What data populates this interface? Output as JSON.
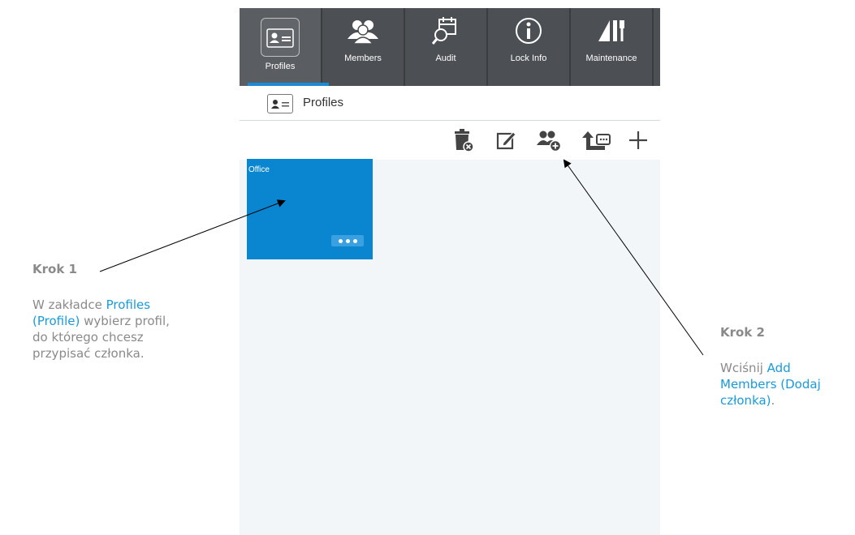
{
  "tabs": [
    {
      "label": "Profiles",
      "icon": "profile-card-icon",
      "active": true
    },
    {
      "label": "Members",
      "icon": "members-icon",
      "active": false
    },
    {
      "label": "Audit",
      "icon": "audit-icon",
      "active": false
    },
    {
      "label": "Lock Info",
      "icon": "info-icon",
      "active": false
    },
    {
      "label": "Maintenance",
      "icon": "maintenance-icon",
      "active": false
    }
  ],
  "breadcrumb": {
    "label": "Profiles",
    "icon": "profile-card-icon"
  },
  "toolbar": [
    {
      "name": "delete-profile",
      "icon": "trash-icon"
    },
    {
      "name": "edit-profile",
      "icon": "edit-icon"
    },
    {
      "name": "add-members",
      "icon": "add-members-icon"
    },
    {
      "name": "upload-profile",
      "icon": "upload-icon"
    },
    {
      "name": "add-profile",
      "icon": "plus-icon"
    }
  ],
  "profile_card": {
    "title": "Office",
    "color": "#0a86d1"
  },
  "annotations": {
    "step1": {
      "title": "Krok 1",
      "text_before": "W zakładce ",
      "highlight": "Profiles (Profile)",
      "text_after": " wybierz profil, do którego chcesz przypisać członka."
    },
    "step2": {
      "title": "Krok 2",
      "text_before": "Wciśnij ",
      "highlight": "Add Members (Dodaj członka)",
      "text_after": "."
    }
  },
  "colors": {
    "accent": "#1a9ad9",
    "tabbar": "#4c4f53",
    "card": "#0a86d1",
    "annotation_text": "#8a8a8a"
  }
}
